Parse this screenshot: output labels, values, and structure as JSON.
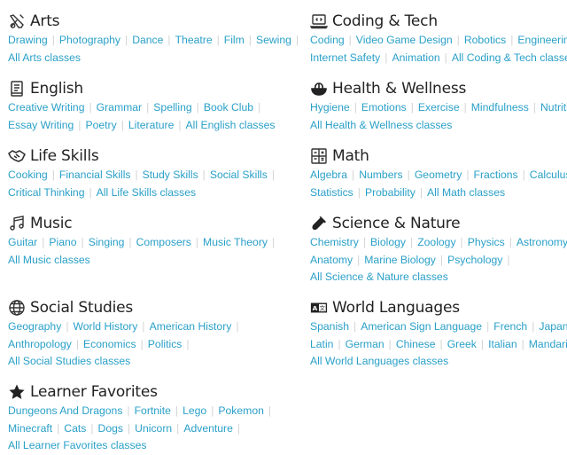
{
  "colors": {
    "link": "#2aa0c8",
    "heading": "#222222",
    "separator": "#d4d4d4"
  },
  "categories": [
    {
      "id": "arts",
      "title": "Arts",
      "icon": "pencil-brush-icon",
      "column": "left",
      "lines": [
        [
          "Drawing",
          "Photography",
          "Dance",
          "Theatre",
          "Film",
          "Sewing"
        ]
      ],
      "all_label": "All Arts classes"
    },
    {
      "id": "english",
      "title": "English",
      "icon": "book-icon",
      "column": "left",
      "lines": [
        [
          "Creative Writing",
          "Grammar",
          "Spelling",
          "Book Club"
        ],
        [
          "Essay Writing",
          "Poetry",
          "Literature"
        ]
      ],
      "all_label": "All English classes",
      "all_inline": true
    },
    {
      "id": "life-skills",
      "title": "Life Skills",
      "icon": "handshake-icon",
      "column": "left",
      "lines": [
        [
          "Cooking",
          "Financial Skills",
          "Study Skills",
          "Social Skills"
        ],
        [
          "Critical Thinking"
        ]
      ],
      "all_label": "All Life Skills classes",
      "all_inline": true
    },
    {
      "id": "music",
      "title": "Music",
      "icon": "music-note-icon",
      "column": "left",
      "lines": [
        [
          "Guitar",
          "Piano",
          "Singing",
          "Composers",
          "Music Theory"
        ]
      ],
      "all_label": "All Music classes"
    },
    {
      "id": "social-studies",
      "title": "Social Studies",
      "icon": "globe-icon",
      "column": "left",
      "lines": [
        [
          "Geography",
          "World History",
          "American History"
        ],
        [
          "Anthropology",
          "Economics",
          "Politics"
        ]
      ],
      "all_label": "All Social Studies classes"
    },
    {
      "id": "learner-favorites",
      "title": "Learner Favorites",
      "icon": "star-icon",
      "column": "left",
      "lines": [
        [
          "Dungeons And Dragons",
          "Fortnite",
          "Lego",
          "Pokemon"
        ],
        [
          "Minecraft",
          "Cats",
          "Dogs",
          "Unicorn",
          "Adventure"
        ]
      ],
      "all_label": "All Learner Favorites classes"
    },
    {
      "id": "coding-tech",
      "title": "Coding & Tech",
      "icon": "laptop-code-icon",
      "column": "right",
      "lines": [
        [
          "Coding",
          "Video Game Design",
          "Robotics",
          "Engineering"
        ],
        [
          "Internet Safety",
          "Animation"
        ]
      ],
      "all_label": "All Coding & Tech classes",
      "all_inline": true
    },
    {
      "id": "health-wellness",
      "title": "Health & Wellness",
      "icon": "salad-bowl-icon",
      "column": "right",
      "lines": [
        [
          "Hygiene",
          "Emotions",
          "Exercise",
          "Mindfulness",
          "Nutrition"
        ]
      ],
      "all_label": "All Health & Wellness classes",
      "no_trailing_sep": true
    },
    {
      "id": "math",
      "title": "Math",
      "icon": "calculator-icon",
      "column": "right",
      "lines": [
        [
          "Algebra",
          "Numbers",
          "Geometry",
          "Fractions",
          "Calculus"
        ],
        [
          "Statistics",
          "Probability"
        ]
      ],
      "all_label": "All Math classes",
      "all_inline": true
    },
    {
      "id": "science-nature",
      "title": "Science & Nature",
      "icon": "test-tube-icon",
      "column": "right",
      "lines": [
        [
          "Chemistry",
          "Biology",
          "Zoology",
          "Physics",
          "Astronomy"
        ],
        [
          "Anatomy",
          "Marine Biology",
          "Psychology"
        ]
      ],
      "all_label": "All Science & Nature classes"
    },
    {
      "id": "world-languages",
      "title": "World Languages",
      "icon": "translate-icon",
      "column": "right",
      "lines": [
        [
          "Spanish",
          "American Sign Language",
          "French",
          "Japanese"
        ],
        [
          "Latin",
          "German",
          "Chinese",
          "Greek",
          "Italian",
          "Mandarin"
        ]
      ],
      "all_label": "All World Languages classes",
      "first_line_no_trailing_sep": true
    }
  ]
}
